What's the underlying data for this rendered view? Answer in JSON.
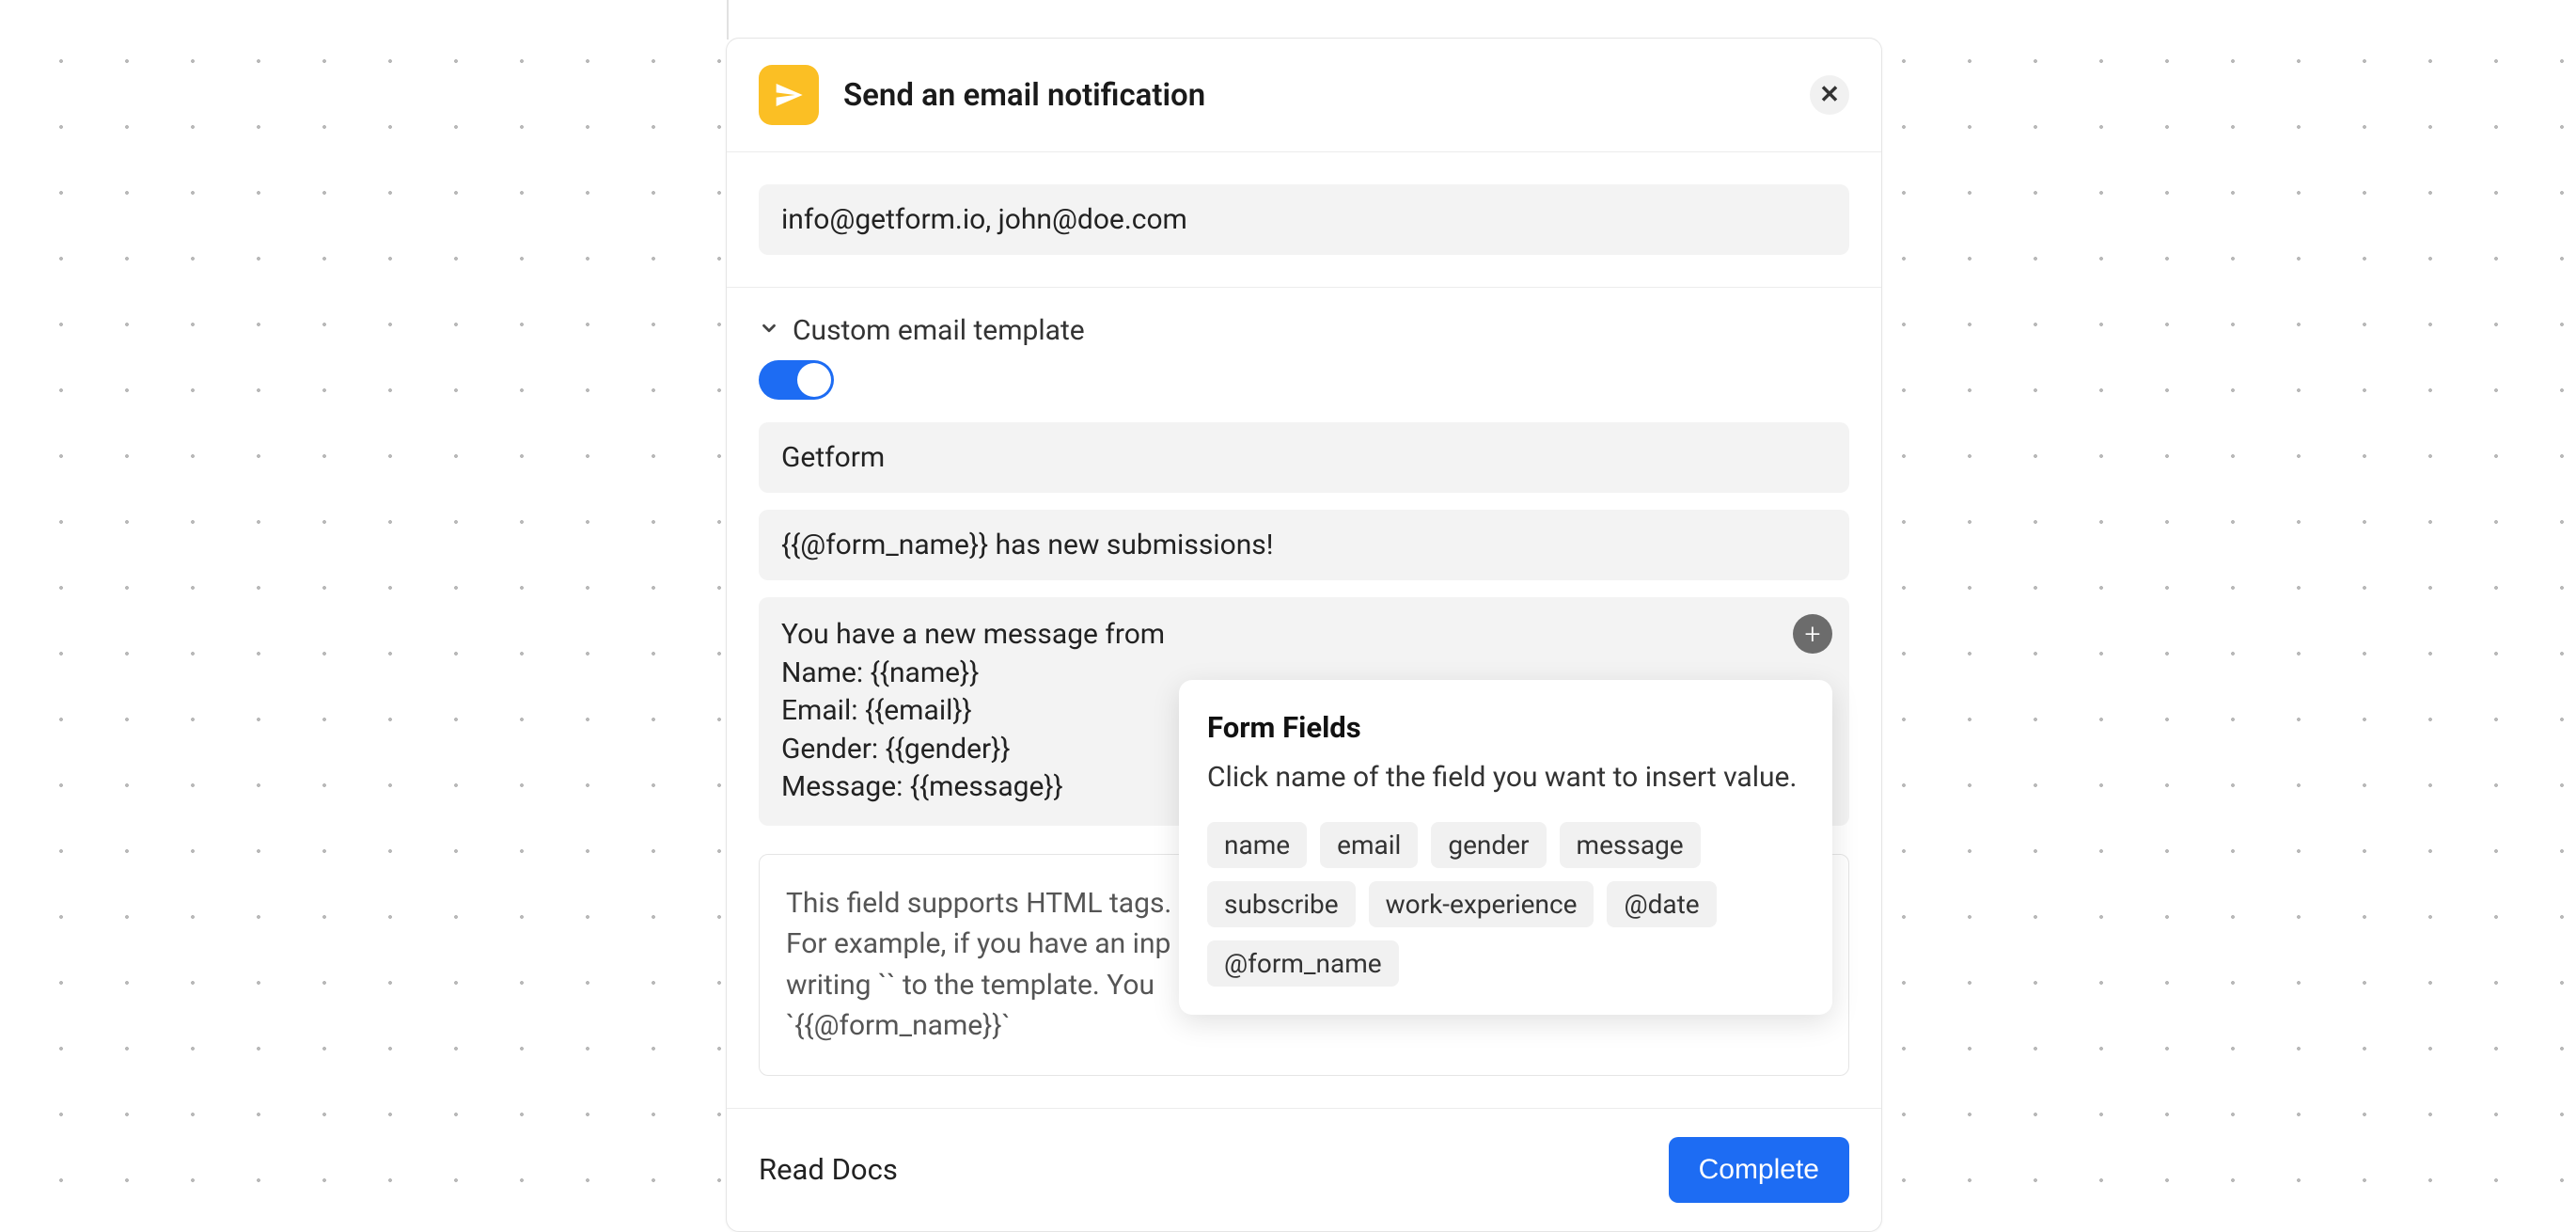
{
  "header": {
    "title": "Send an email notification"
  },
  "recipients": {
    "value": "info@getform.io, john@doe.com"
  },
  "template": {
    "collapse_label": "Custom email template",
    "toggle_on": true,
    "from_name": "Getform",
    "subject": "{{@form_name}} has new submissions!",
    "body": "You have a new message from\nName: {{name}}\nEmail: {{email}}\nGender: {{gender}}\nMessage: {{message}}",
    "help_text": "This field supports HTML tags.\nFor example, if you have an inp\nwriting `` to the template. You \n`{{@form_name}}`"
  },
  "footer": {
    "docs_label": "Read Docs",
    "complete_label": "Complete"
  },
  "popover": {
    "title": "Form Fields",
    "description": "Click name of the field you want to insert value.",
    "fields": [
      "name",
      "email",
      "gender",
      "message",
      "subscribe",
      "work-experience",
      "@date",
      "@form_name"
    ]
  }
}
